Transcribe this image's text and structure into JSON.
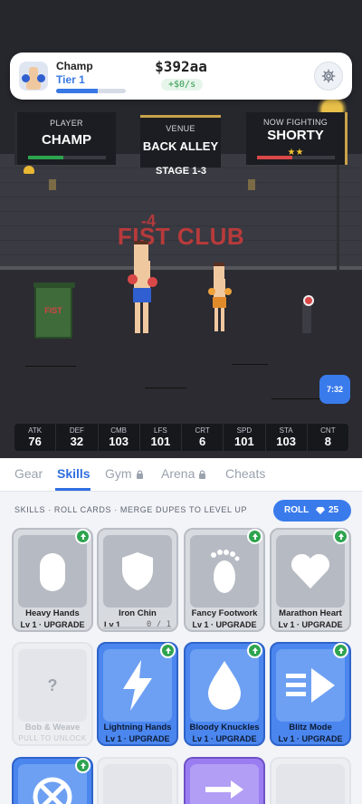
{
  "player": {
    "name": "Champ",
    "tier": "Tier 1",
    "tier_progress": 0.6,
    "money": "$392aa",
    "income_rate": "+$0/s"
  },
  "panels": {
    "player_label": "PLAYER",
    "player_name": "CHAMP",
    "player_hp": 0.45,
    "venue_label": "VENUE",
    "venue_name": "BACK ALLEY",
    "opponent_label": "NOW FIGHTING",
    "opponent_name": "SHORTY",
    "opponent_stars": "★★",
    "opponent_hp": 0.45,
    "stage": "STAGE 1-3"
  },
  "scene": {
    "damage_popup": "-4",
    "club_title": "FIST CLUB",
    "bin_label": "FIST",
    "timer": "7:32"
  },
  "stats": [
    {
      "label": "ATK",
      "value": "76"
    },
    {
      "label": "DEF",
      "value": "32"
    },
    {
      "label": "CMB",
      "value": "103"
    },
    {
      "label": "LFS",
      "value": "101"
    },
    {
      "label": "CRT",
      "value": "6"
    },
    {
      "label": "SPD",
      "value": "101"
    },
    {
      "label": "STA",
      "value": "103"
    },
    {
      "label": "CNT",
      "value": "8"
    }
  ],
  "tabs": {
    "gear": "Gear",
    "skills": "Skills",
    "gym": "Gym",
    "arena": "Arena",
    "cheats": "Cheats"
  },
  "skills_hint": "SKILLS · ROLL CARDS · MERGE DUPES TO LEVEL UP",
  "roll": {
    "label": "ROLL",
    "cost": "25"
  },
  "cards": [
    {
      "name": "Heavy Hands",
      "status": "Lv 1 · UPGRADE"
    },
    {
      "name": "Iron Chin",
      "level": "Lv 1",
      "progress": "0 / 1"
    },
    {
      "name": "Fancy Footwork",
      "status": "Lv 1 · UPGRADE"
    },
    {
      "name": "Marathon Heart",
      "status": "Lv 1 · UPGRADE"
    },
    {
      "name": "Bob & Weave",
      "status": "PULL TO UNLOCK",
      "locked_glyph": "?"
    },
    {
      "name": "Lightning Hands",
      "status": "Lv 1 · UPGRADE"
    },
    {
      "name": "Bloody Knuckles",
      "status": "Lv 1 · UPGRADE"
    },
    {
      "name": "Blitz Mode",
      "status": "Lv 1 · UPGRADE"
    }
  ],
  "colors": {
    "accent": "#3a7bec",
    "upgrade": "#2ea44f",
    "player_hp": "#2ea44f",
    "opponent_hp": "#d94848"
  }
}
